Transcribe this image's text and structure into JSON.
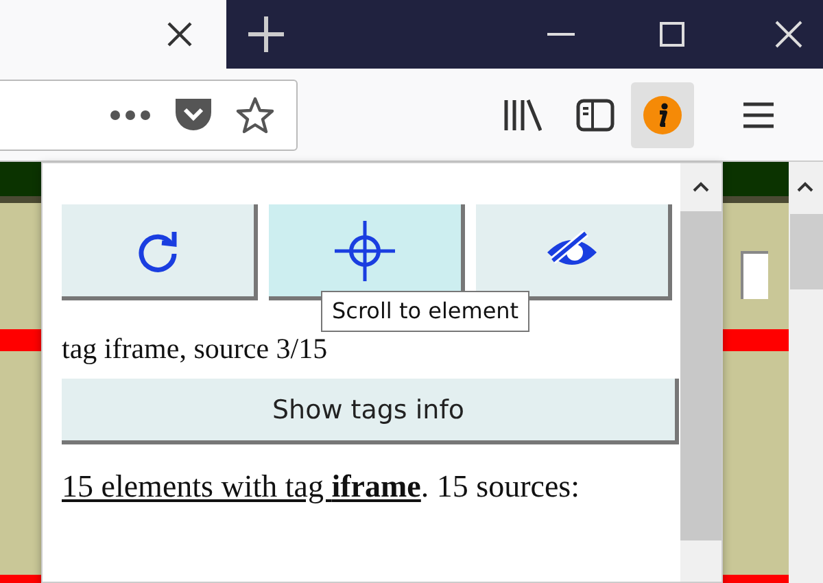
{
  "toolbar": {
    "extension_active": true
  },
  "popup": {
    "buttons": [
      {
        "kind": "refresh",
        "hovered": false
      },
      {
        "kind": "locate",
        "hovered": true
      },
      {
        "kind": "hide",
        "hovered": false
      }
    ],
    "tooltip": "Scroll to element",
    "status": "tag iframe, source 3/15",
    "show_tags_button": "Show tags info",
    "summary": {
      "link": "15 elements with tag **iframe**",
      "rest": ". 15 sources:"
    }
  }
}
